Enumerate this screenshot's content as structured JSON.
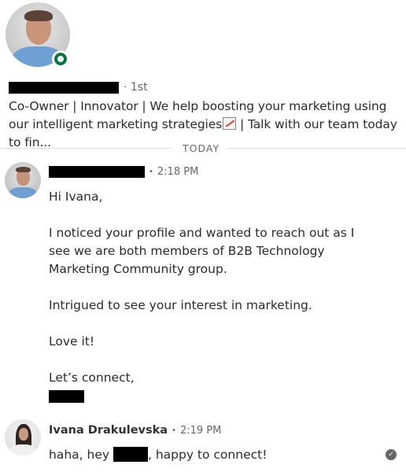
{
  "profile": {
    "name_redacted": true,
    "degree": "· 1st",
    "status": "online",
    "headline_part1": "Co-Owner | Innovator | We help boosting your marketing using our intelligent marketing strategies",
    "headline_emoji": "chart-increasing-icon",
    "headline_part2": " | Talk with our team today to fin..."
  },
  "divider": {
    "label": "TODAY"
  },
  "messages": [
    {
      "sender_redacted": true,
      "separator": "•",
      "time": "2:18 PM",
      "lines": [
        "Hi Ivana,",
        "",
        "I noticed your profile and wanted to reach out as I see we are both members of B2B Technology Marketing Community group.",
        "",
        "Intrigued to see your interest in marketing.",
        "",
        "Love it!",
        "",
        "Let’s connect,"
      ],
      "signature_redacted": true
    },
    {
      "sender": "Ivana Drakulevska",
      "separator": "•",
      "time": "2:19 PM",
      "text_before": "haha, hey ",
      "text_after": ", happy to connect!",
      "read_receipt": "seen-check-icon"
    }
  ],
  "colors": {
    "online": "#057642",
    "text": "#2b2b2b",
    "muted": "#666666",
    "divider": "#dcdcdc"
  }
}
